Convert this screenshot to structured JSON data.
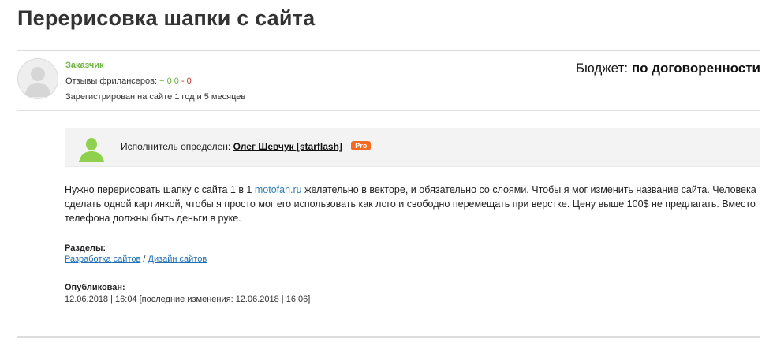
{
  "page": {
    "title": "Перерисовка шапки с сайта"
  },
  "customer": {
    "role": "Заказчик",
    "reviews_label": "Отзывы фрилансеров:",
    "reviews_positive": "+ 0",
    "reviews_neutral": "0",
    "reviews_negative": "- 0",
    "registered": "Зарегистрирован на сайте 1 год и 5 месяцев"
  },
  "budget": {
    "label": "Бюджет:",
    "value": "по договоренности"
  },
  "executor": {
    "label": "Исполнитель определен:",
    "name": "Олег Шевчук [starflash]",
    "badge": "Pro"
  },
  "description": {
    "before_link": "Нужно перерисовать шапку с сайта 1 в 1 ",
    "link": "motofan.ru",
    "after_link": " желательно в векторе, и обязательно со слоями. Чтобы я мог изменить название сайта. Человека сделать одной картинкой, чтобы я просто мог его использовать как лого и свободно перемещать при верстке. Цену выше 100$ не предлагать. Вместо телефона должны быть деньги в руке."
  },
  "sections": {
    "label": "Разделы:",
    "items": [
      "Разработка сайтов",
      "Дизайн сайтов"
    ],
    "separator": "/"
  },
  "published": {
    "label": "Опубликован:",
    "value": "12.06.2018 | 16:04 [последние изменения: 12.06.2018 | 16:06]"
  },
  "colors": {
    "accent_green": "#6db33f",
    "link_blue": "#1f6fb2",
    "pro_orange": "#f26b21"
  }
}
